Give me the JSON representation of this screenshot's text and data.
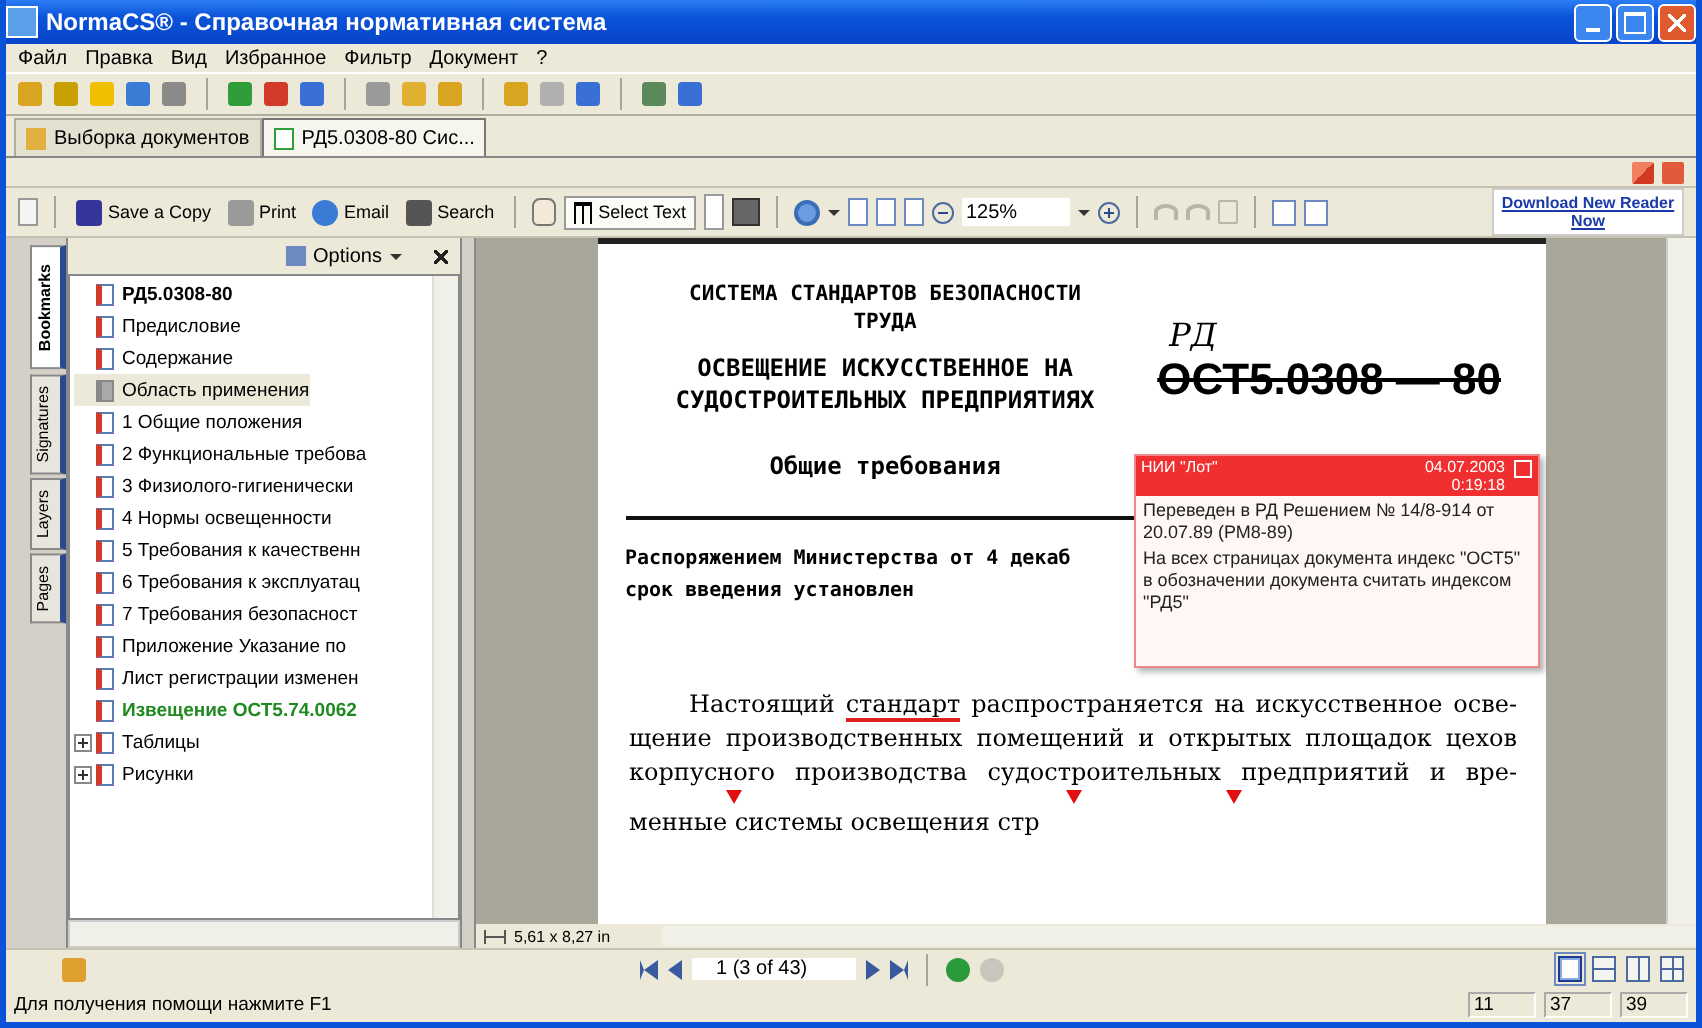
{
  "window": {
    "title": "NormaCS® - Справочная нормативная система"
  },
  "menu": [
    "Файл",
    "Правка",
    "Вид",
    "Избранное",
    "Фильтр",
    "Документ",
    "?"
  ],
  "tabs": [
    {
      "label": "Выборка документов",
      "selected": false
    },
    {
      "label": "РД5.0308-80 Сис...",
      "selected": true
    }
  ],
  "reader_toolbar": {
    "buttons": [
      {
        "kind": "save",
        "label": "Save a Copy"
      },
      {
        "kind": "print",
        "label": "Print"
      },
      {
        "kind": "email",
        "label": "Email"
      },
      {
        "kind": "search",
        "label": "Search"
      }
    ],
    "select_text": "Select Text",
    "zoom": "125%",
    "edit_buttons": [
      {
        "kind": "undo",
        "disabled": true
      },
      {
        "kind": "redo",
        "disabled": true
      },
      {
        "kind": "copy",
        "disabled": true
      }
    ],
    "download_link": "Download New Reader Now"
  },
  "side_tabs": [
    {
      "label": "Bookmarks",
      "selected": true
    },
    {
      "label": "Signatures",
      "selected": false
    },
    {
      "label": "Layers",
      "selected": false
    },
    {
      "label": "Pages",
      "selected": false
    }
  ],
  "bookmarks": {
    "options": "Options",
    "items": [
      {
        "kind": "title",
        "label": "РД5.0308-80",
        "selected": false
      },
      {
        "kind": "section",
        "label": "Предисловие",
        "selected": false
      },
      {
        "kind": "section",
        "label": "Содержание",
        "selected": false
      },
      {
        "kind": "section",
        "label": "Область применения",
        "selected": true
      },
      {
        "kind": "section",
        "label": "1 Общие положения",
        "selected": false
      },
      {
        "kind": "section",
        "label": "2 Функциональные требова",
        "selected": false
      },
      {
        "kind": "section",
        "label": "3 Физиолого-гигиенически",
        "selected": false
      },
      {
        "kind": "section",
        "label": "4 Нормы освещенности",
        "selected": false
      },
      {
        "kind": "section",
        "label": "5 Требования к качественн",
        "selected": false
      },
      {
        "kind": "section",
        "label": "6 Требования к эксплуатац",
        "selected": false
      },
      {
        "kind": "section",
        "label": "7 Требования безопасност",
        "selected": false
      },
      {
        "kind": "section",
        "label": "Приложение  Указание по",
        "selected": false
      },
      {
        "kind": "section",
        "label": "Лист регистрации изменен",
        "selected": false
      },
      {
        "kind": "notice",
        "label": "Извещение ОСТ5.74.0062",
        "selected": false
      },
      {
        "kind": "group",
        "label": "Таблицы",
        "selected": false,
        "expanded": false
      },
      {
        "kind": "group",
        "label": "Рисунки",
        "selected": false,
        "expanded": false
      }
    ]
  },
  "document": {
    "series": [
      "СИСТЕМА СТАНДАРТОВ БЕЗОПАСНОСТИ",
      "ТРУДА"
    ],
    "title": [
      "ОСВЕЩЕНИЕ ИСКУССТВЕННОЕ НА",
      "СУДОСТРОИТЕЛЬНЫХ ПРЕДПРИЯТИЯХ"
    ],
    "subtitle": "Общие требования",
    "handwritten": "РД",
    "number": "ОСТ5.0308 — 80",
    "decree": "Распоряжением Министерства от 4 декаб",
    "term": "срок введения установлен",
    "body": [
      [
        {
          "text": "Настоящий ",
          "marked": false
        },
        {
          "text": "стандарт",
          "marked": true
        },
        {
          "text": " распространяется на искусственное осве-",
          "marked": false
        }
      ],
      [
        {
          "text": "щение производственных помещений и открытых площадок цехов",
          "marked": false
        }
      ],
      [
        {
          "text": "корпусного производства  судостроительных  предприятий и вре-",
          "marked": false
        }
      ],
      [
        {
          "text": "менные системы освещения стр",
          "marked": false
        }
      ]
    ]
  },
  "note": {
    "author": "НИИ \"Лот\"",
    "date": "04.07.2003",
    "time": "0:19:18",
    "text": [
      "Переведен в РД Решением № 14/8-914 от 20.07.89 (РМ8-89)",
      "На всех страницах документа индекс \"ОСТ5\" в обозначении документа считать индексом \"РД5\""
    ]
  },
  "page_size": "5,61 x 8,27 in",
  "navigation": {
    "page": "1  (3 of 43)",
    "back_disabled": false,
    "forward_disabled": true
  },
  "views": [
    {
      "kind": "single",
      "selected": true
    },
    {
      "kind": "continuous",
      "selected": false
    },
    {
      "kind": "facing",
      "selected": false
    },
    {
      "kind": "continuous_facing",
      "selected": false
    }
  ],
  "status_bar": {
    "text": "Для получения помощи нажмите F1",
    "fields": [
      "11",
      "37",
      "39"
    ]
  }
}
